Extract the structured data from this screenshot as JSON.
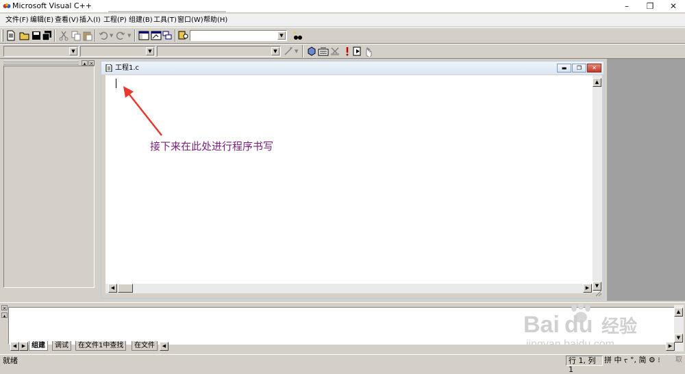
{
  "window": {
    "title": "Microsoft Visual C++",
    "controls": {
      "minimize": "–",
      "restore": "❐",
      "close": "✕"
    }
  },
  "menu": [
    "文件(F)",
    "编辑(E)",
    "查看(V)",
    "插入(I)",
    "工程(P)",
    "组建(B)",
    "工具(T)",
    "窗口(W)",
    "帮助(H)"
  ],
  "document": {
    "tab_title": "工程1.c",
    "annotation": "接下来在此处进行程序书写"
  },
  "output": {
    "tabs": [
      "组建",
      "调试",
      "在文件1中查找",
      "在文件"
    ]
  },
  "status": {
    "ready": "就绪",
    "position": "行 1, 列 1",
    "ime": "拼 中 ᠵ °, 简 ⚙ ⁝",
    "ime_end": "取"
  },
  "watermark": {
    "brand": "Bai",
    "brand2": "du",
    "cn": "经验",
    "url": "jingyan.baidu.com"
  },
  "colors": {
    "chrome": "#d4d0c8",
    "annotation": "#7a1e7a",
    "arrow": "#e8382e",
    "mdi_dark": "#a0a0a0"
  }
}
